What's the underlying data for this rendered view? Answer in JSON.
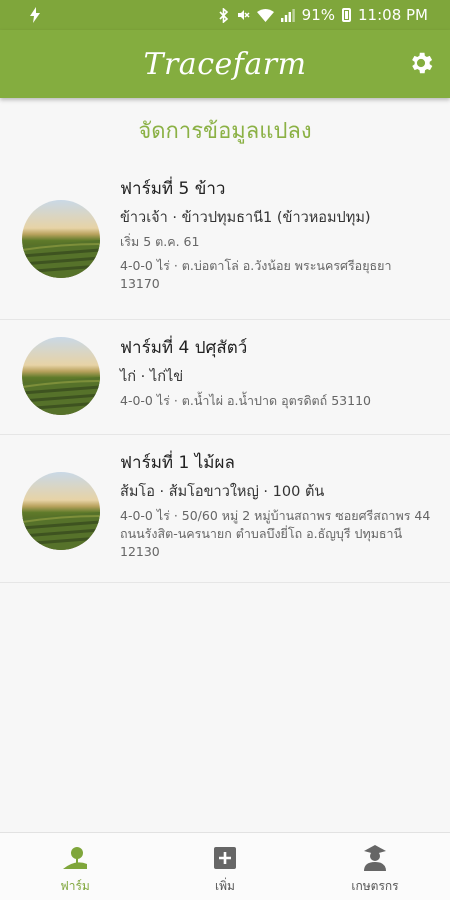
{
  "status_bar": {
    "battery_percent": "91%",
    "time": "11:08 PM",
    "icons": [
      "charging-icon",
      "bluetooth-icon",
      "mute-icon",
      "wifi-icon",
      "signal-icon",
      "battery-icon"
    ]
  },
  "app": {
    "title": "Tracefarm",
    "brand_color": "#84ad3f",
    "accent_text_color": "#8bb145"
  },
  "page": {
    "heading": "จัดการข้อมูลแปลง"
  },
  "farms": [
    {
      "name": "ฟาร์มที่ 5 ข้าว",
      "detail": "ข้าวเจ้า · ข้าวปทุมธานี1 (ข้าวหอมปทุม)",
      "start": "เริ่ม 5 ต.ค. 61",
      "location": "4-0-0 ไร่ · ต.บ่อตาโล่ อ.วังน้อย พระนครศรีอยุธยา 13170"
    },
    {
      "name": "ฟาร์มที่ 4 ปศุสัตว์",
      "detail": "ไก่ · ไก่ไข่",
      "location": "4-0-0 ไร่ · ต.น้ำไผ่ อ.น้ำปาด อุตรดิตถ์ 53110"
    },
    {
      "name": "ฟาร์มที่ 1 ไม้ผล",
      "detail": "ส้มโอ · ส้มโอขาวใหญ่ · 100 ต้น",
      "location": "4-0-0 ไร่ · 50/60 หมู่ 2 หมู่บ้านสถาพร ซอยศรีสถาพร 44 ถนนรังสิต-นครนายก ตำบลบึงยี่โถ อ.ธัญบุรี ปทุมธานี 12130"
    }
  ],
  "bottom_nav": [
    {
      "label": "ฟาร์ม",
      "icon": "farm-icon",
      "active": true
    },
    {
      "label": "เพิ่ม",
      "icon": "add-box-icon",
      "active": false
    },
    {
      "label": "เกษตรกร",
      "icon": "farmer-icon",
      "active": false
    }
  ]
}
